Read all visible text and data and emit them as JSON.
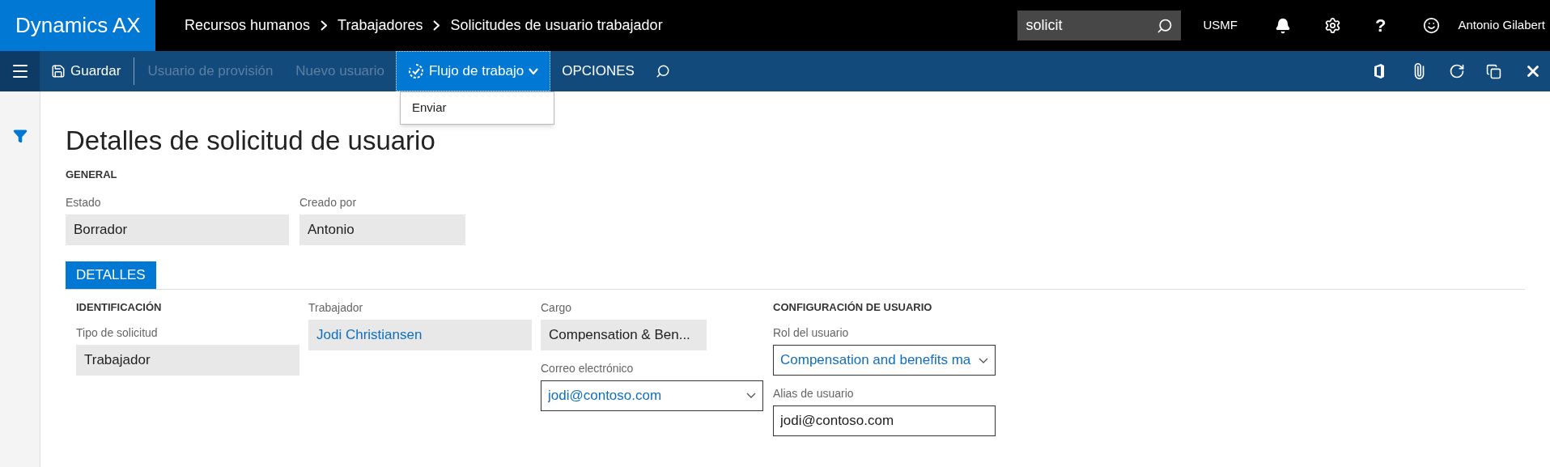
{
  "app_name": "Dynamics AX",
  "breadcrumb": [
    "Recursos humanos",
    "Trabajadores",
    "Solicitudes de usuario trabajador"
  ],
  "search": {
    "value": "solicit"
  },
  "company": "USMF",
  "help": "?",
  "user_name": "Antonio Gilabert",
  "action_bar": {
    "items": [
      {
        "label": "Guardar",
        "kind": "save",
        "disabled": false
      },
      {
        "label": "Usuario de provisión",
        "kind": "plain",
        "disabled": true
      },
      {
        "label": "Nuevo usuario",
        "kind": "plain",
        "disabled": true
      },
      {
        "label": "Flujo de trabajo",
        "kind": "menu",
        "disabled": false,
        "expanded": true
      },
      {
        "label": "OPCIONES",
        "kind": "plain",
        "disabled": false
      }
    ],
    "menu": [
      "Enviar"
    ]
  },
  "page_title": "Detalles de solicitud de usuario",
  "general": {
    "heading": "GENERAL",
    "fields": [
      {
        "label": "Estado",
        "value": "Borrador",
        "kind": "readonly",
        "link": false
      },
      {
        "label": "Creado por",
        "value": "Antonio",
        "kind": "readonly",
        "link": false
      }
    ]
  },
  "tabs": [
    {
      "label": "DETALLES",
      "selected": true
    }
  ],
  "columns": [
    {
      "heading": "IDENTIFICACIÓN",
      "fields": [
        {
          "label": "Tipo de solicitud",
          "value": "Trabajador",
          "kind": "readonly",
          "link": false
        }
      ]
    },
    {
      "fields": [
        {
          "label": "Trabajador",
          "value": "Jodi Christiansen",
          "kind": "readonly",
          "link": true
        }
      ]
    },
    {
      "fields": [
        {
          "label": "Cargo",
          "value": "Compensation & Ben...",
          "kind": "readonly-short",
          "link": false
        },
        {
          "label": "Correo electrónico",
          "value": "jodi@contoso.com",
          "kind": "dropdown",
          "link": true
        }
      ]
    },
    {
      "heading": "CONFIGURACIÓN DE USUARIO",
      "fields": [
        {
          "label": "Rol del usuario",
          "value": "Compensation and benefits ma",
          "kind": "dropdown",
          "link": true
        },
        {
          "label": "Alias de usuario",
          "value": "jodi@contoso.com",
          "kind": "input",
          "link": false
        }
      ]
    }
  ]
}
